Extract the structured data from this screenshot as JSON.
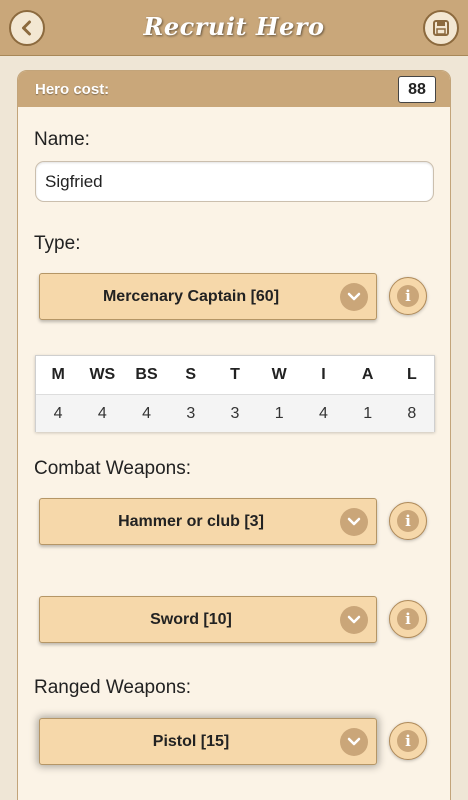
{
  "header": {
    "title": "Recruit Hero",
    "back_icon": "chevron-left-icon",
    "save_icon": "floppy-disk-icon"
  },
  "hero_cost": {
    "label": "Hero cost:",
    "value": "88"
  },
  "name": {
    "label": "Name:",
    "value": "Sigfried"
  },
  "type": {
    "label": "Type:",
    "selected": "Mercenary Captain [60]"
  },
  "stats": {
    "headers": [
      "M",
      "WS",
      "BS",
      "S",
      "T",
      "W",
      "I",
      "A",
      "L"
    ],
    "values": [
      "4",
      "4",
      "4",
      "3",
      "3",
      "1",
      "4",
      "1",
      "8"
    ]
  },
  "combat_weapons": {
    "label": "Combat Weapons:",
    "slot1": "Hammer or club [3]",
    "slot2": "Sword [10]"
  },
  "ranged_weapons": {
    "label": "Ranged Weapons:",
    "slot1": "Pistol [15]"
  },
  "colors": {
    "accent": "#c9a77a",
    "select_bg": "#f6d8aa",
    "panel_bg": "#fbf3e6"
  }
}
